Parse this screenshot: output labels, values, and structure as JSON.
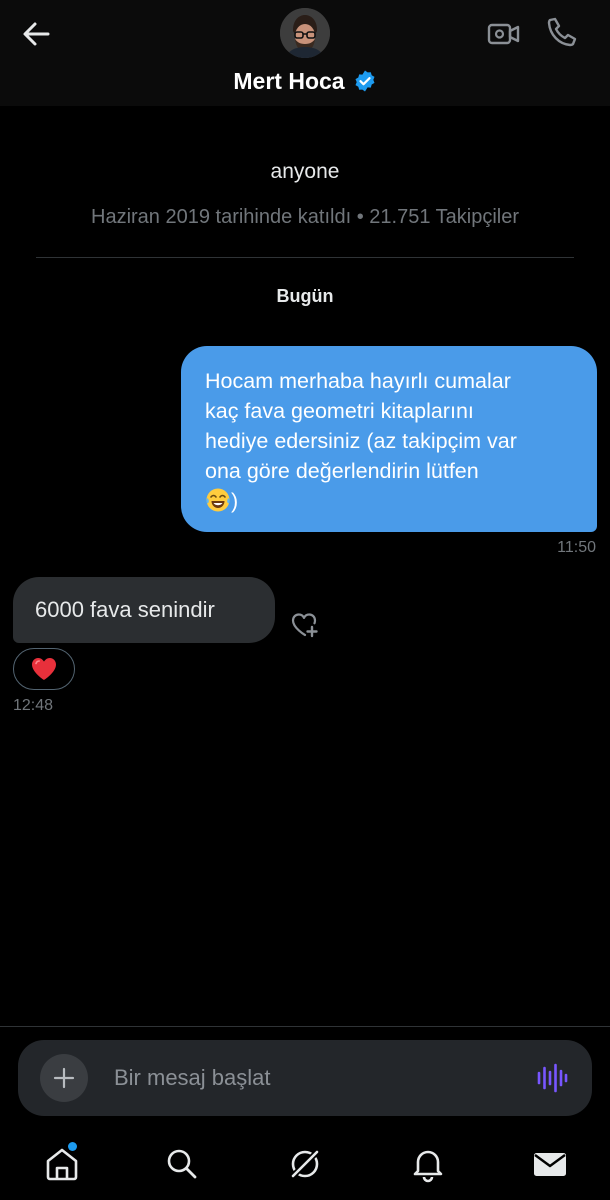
{
  "header": {
    "name": "Mert Hoca",
    "verified": true,
    "icons": {
      "back": "arrow-left-icon",
      "verified": "verified-badge-icon",
      "video": "video-call-icon",
      "call": "phone-icon"
    }
  },
  "profile": {
    "handle": "anyone",
    "meta": "Haziran 2019 tarihinde katıldı • 21.751 Takipçiler"
  },
  "conversation": {
    "date_separator": "Bugün",
    "messages": [
      {
        "direction": "outgoing",
        "lines": [
          "Hocam merhaba hayırlı cumalar",
          "kaç fava geometri kitaplarını",
          "hediye edersiniz (az takipçim var",
          "ona göre değerlendirin lütfen"
        ],
        "last_line_suffix": ")",
        "emoji": "face-with-tears-of-joy",
        "time": "11:50"
      },
      {
        "direction": "incoming",
        "text": "6000 fava senindir",
        "reaction": "red-heart",
        "time": "12:48"
      }
    ]
  },
  "composer": {
    "placeholder": "Bir mesaj başlat",
    "icons": {
      "add": "plus-icon",
      "voice": "voice-waveform-icon"
    }
  },
  "bottom_nav": {
    "items": [
      {
        "icon": "home-icon",
        "has_badge": true
      },
      {
        "icon": "search-icon",
        "has_badge": false
      },
      {
        "icon": "grok-icon",
        "has_badge": false
      },
      {
        "icon": "bell-icon",
        "has_badge": false
      },
      {
        "icon": "mail-icon",
        "has_badge": false
      }
    ]
  },
  "colors": {
    "background": "#000000",
    "outgoing_bubble": "#4a9be9",
    "incoming_bubble": "#2b2e31",
    "muted_text": "#71767b",
    "accent": "#1d9bf0",
    "verified_badge": "#1d9bf0",
    "voice_icon": "#7856ff"
  }
}
